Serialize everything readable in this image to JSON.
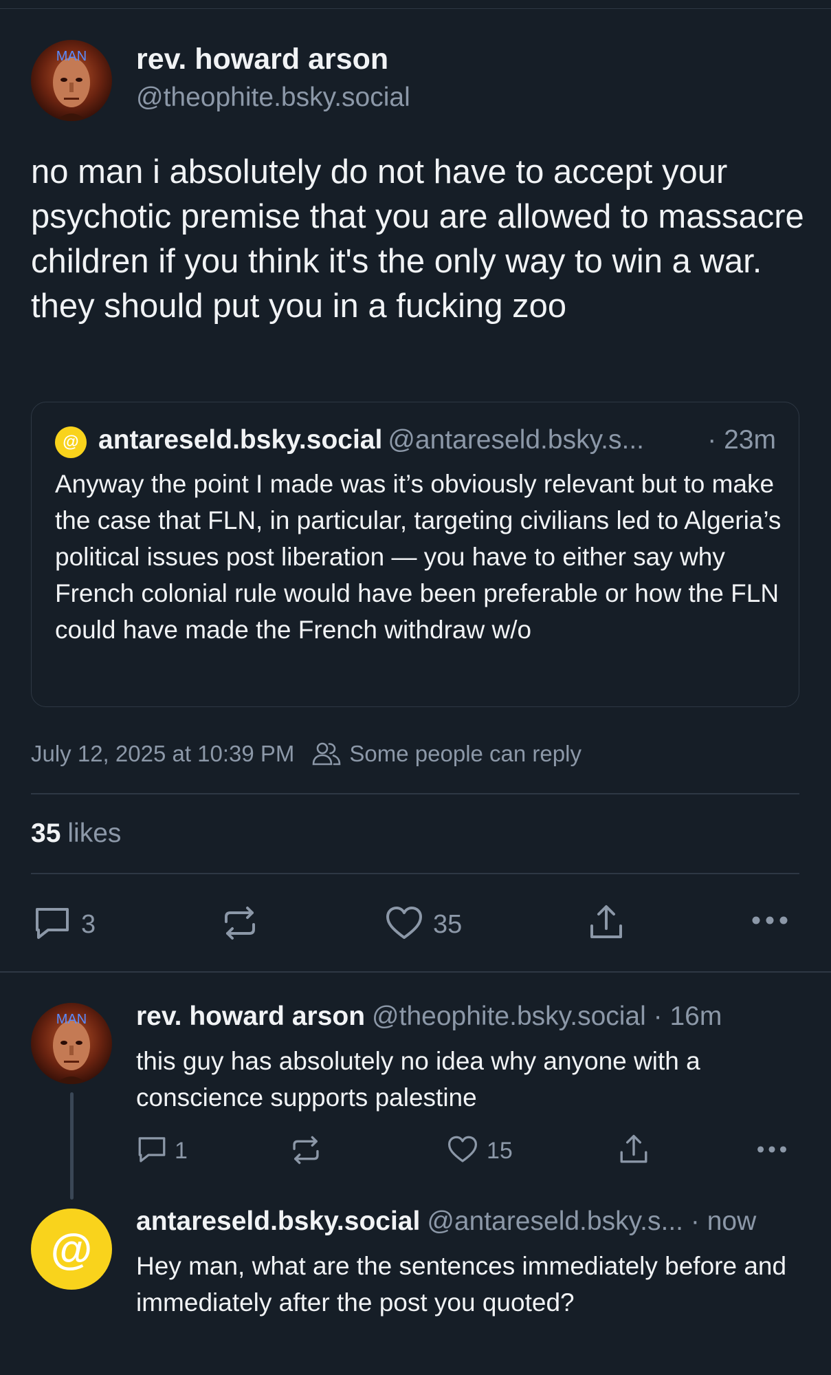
{
  "main_post": {
    "display_name": "rev. howard arson",
    "handle": "@theophite.bsky.social",
    "avatar_text": "MAN",
    "text": "no man i absolutely do not have to accept your psychotic premise that you are allowed to massacre children if you think it's the only way to win a war. they should put you in a fucking zoo",
    "quote": {
      "avatar_symbol": "@",
      "display_name": "antareseld.bsky.social",
      "handle": "@antareseld.bsky.s...",
      "time": "· 23m",
      "text": "Anyway the point I made was it’s obviously relevant but to make the case that FLN, in particular, targeting civilians led to Algeria’s political issues post liberation — you have to either say why French colonial rule would have been preferable or how the FLN could have made the French withdraw w/o"
    },
    "timestamp": "July 12, 2025 at 10:39 PM",
    "reply_setting": "Some people can reply",
    "likes_count": "35",
    "likes_label": "likes",
    "actions": {
      "reply_count": "3",
      "like_count": "35"
    }
  },
  "replies": [
    {
      "display_name": "rev. howard arson",
      "handle": "@theophite.bsky.social",
      "time": " · 16m",
      "avatar_text": "MAN",
      "text": "this guy has absolutely no idea why anyone with a conscience supports palestine",
      "actions": {
        "reply_count": "1",
        "like_count": "15"
      }
    },
    {
      "display_name": "antareseld.bsky.social",
      "handle": "@antareseld.bsky.s...",
      "time": " · now",
      "avatar_symbol": "@",
      "text": "Hey man, what are the sentences immediately before and immediately after the post you quoted?"
    }
  ],
  "icons": {
    "reply": "reply-icon",
    "repost": "repost-icon",
    "like": "heart-icon",
    "share": "share-icon",
    "more": "more-icon",
    "people": "people-icon"
  },
  "colors": {
    "background": "#161e27",
    "border": "#2e3844",
    "text": "#f1f3f5",
    "muted": "#8c98a8",
    "default_avatar": "#f9d31c"
  }
}
